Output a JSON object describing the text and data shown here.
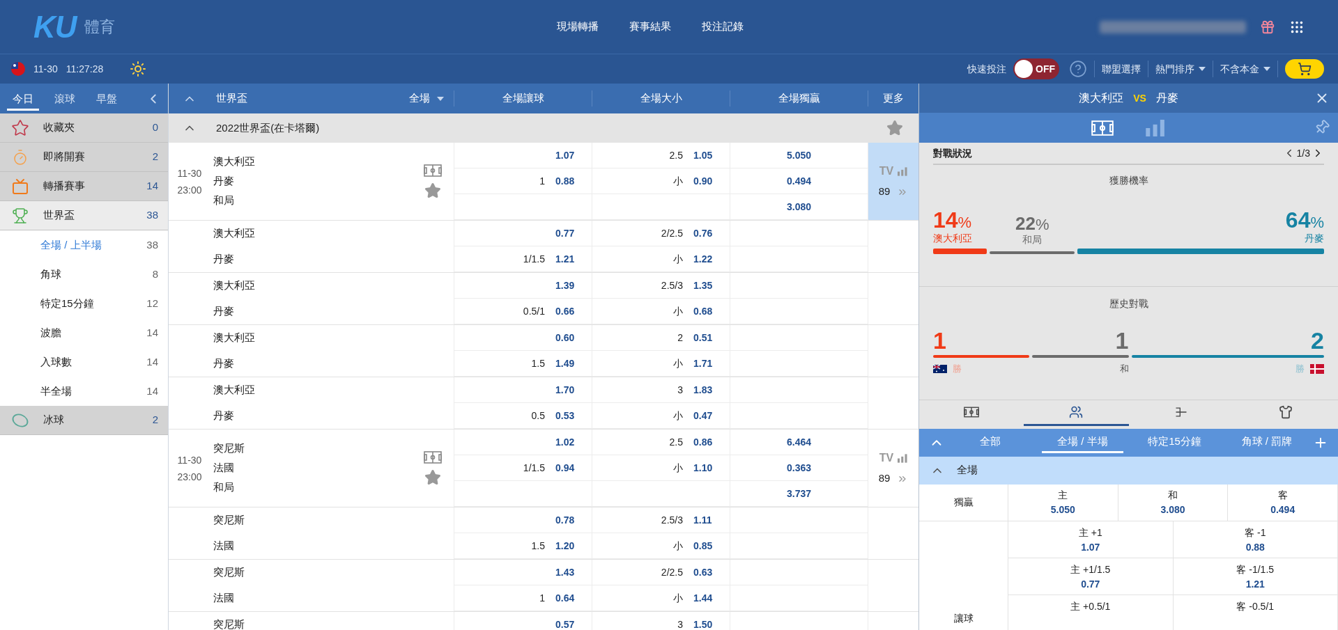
{
  "header": {
    "logo": {
      "mark": "KU",
      "name": "體育"
    },
    "nav": [
      "現場轉播",
      "賽事結果",
      "投注記錄"
    ]
  },
  "subbar": {
    "date": "11-30",
    "time": "11:27:28",
    "quick_bet": {
      "label": "快速投注",
      "on": false,
      "state_label": "OFF"
    },
    "links": [
      {
        "label": "聯盟選擇",
        "dropdown": false
      },
      {
        "label": "熱門排序",
        "dropdown": true
      },
      {
        "label": "不含本金",
        "dropdown": true
      }
    ]
  },
  "sidebar": {
    "tabs": [
      {
        "label": "今日",
        "selected": true
      },
      {
        "label": "滾球",
        "selected": false
      },
      {
        "label": "早盤",
        "selected": false
      }
    ],
    "items": [
      {
        "kind": "favorites",
        "label": "收藏夾",
        "count": "0",
        "expanded": false
      },
      {
        "kind": "upcoming",
        "label": "即將開賽",
        "count": "2",
        "expanded": false
      },
      {
        "kind": "tv",
        "label": "轉播賽事",
        "count": "14",
        "expanded": false
      },
      {
        "kind": "cup",
        "label": "世界盃",
        "count": "38",
        "expanded": true,
        "children": [
          {
            "label": "全場 / 上半場",
            "count": "38",
            "selected": true
          },
          {
            "label": "角球",
            "count": "8",
            "selected": false
          },
          {
            "label": "特定15分鐘",
            "count": "12",
            "selected": false
          },
          {
            "label": "波膽",
            "count": "14",
            "selected": false
          },
          {
            "label": "入球數",
            "count": "14",
            "selected": false
          },
          {
            "label": "半全場",
            "count": "14",
            "selected": false
          }
        ]
      },
      {
        "kind": "hockey",
        "label": "冰球",
        "count": "2",
        "expanded": false
      }
    ]
  },
  "odds_table": {
    "league": "世界盃",
    "period": "全場",
    "columns": [
      "全場讓球",
      "全場大小",
      "全場獨贏"
    ],
    "more": "更多",
    "group": "2022世界盃(在卡塔爾)",
    "matches": [
      {
        "date": "11-30",
        "time": "23:00",
        "tv": {
          "label": "TV",
          "count": "89",
          "selected": true
        },
        "blocks": [
          {
            "teams": [
              "澳大利亞",
              "丹麥",
              "和局"
            ],
            "handicap": [
              {
                "odds": "1.07"
              },
              {
                "line": "1",
                "odds": "0.88"
              }
            ],
            "total": [
              {
                "line": "2.5",
                "odds": "1.05"
              },
              {
                "line": "小",
                "odds": "0.90"
              }
            ],
            "moneyline": [
              "5.050",
              "0.494",
              "3.080"
            ]
          },
          {
            "teams": [
              "澳大利亞",
              "丹麥"
            ],
            "handicap": [
              {
                "odds": "0.77"
              },
              {
                "line": "1/1.5",
                "odds": "1.21"
              }
            ],
            "total": [
              {
                "line": "2/2.5",
                "odds": "0.76"
              },
              {
                "line": "小",
                "odds": "1.22"
              }
            ]
          },
          {
            "teams": [
              "澳大利亞",
              "丹麥"
            ],
            "handicap": [
              {
                "odds": "1.39"
              },
              {
                "line": "0.5/1",
                "odds": "0.66"
              }
            ],
            "total": [
              {
                "line": "2.5/3",
                "odds": "1.35"
              },
              {
                "line": "小",
                "odds": "0.68"
              }
            ]
          },
          {
            "teams": [
              "澳大利亞",
              "丹麥"
            ],
            "handicap": [
              {
                "odds": "0.60"
              },
              {
                "line": "1.5",
                "odds": "1.49"
              }
            ],
            "total": [
              {
                "line": "2",
                "odds": "0.51"
              },
              {
                "line": "小",
                "odds": "1.71"
              }
            ]
          },
          {
            "teams": [
              "澳大利亞",
              "丹麥"
            ],
            "handicap": [
              {
                "odds": "1.70"
              },
              {
                "line": "0.5",
                "odds": "0.53"
              }
            ],
            "total": [
              {
                "line": "3",
                "odds": "1.83"
              },
              {
                "line": "小",
                "odds": "0.47"
              }
            ]
          }
        ]
      },
      {
        "date": "11-30",
        "time": "23:00",
        "tv": {
          "label": "TV",
          "count": "89",
          "selected": false
        },
        "blocks": [
          {
            "teams": [
              "突尼斯",
              "法國",
              "和局"
            ],
            "handicap": [
              {
                "odds": "1.02"
              },
              {
                "line": "1/1.5",
                "odds": "0.94"
              }
            ],
            "total": [
              {
                "line": "2.5",
                "odds": "0.86"
              },
              {
                "line": "小",
                "odds": "1.10"
              }
            ],
            "moneyline": [
              "6.464",
              "0.363",
              "3.737"
            ]
          },
          {
            "teams": [
              "突尼斯",
              "法國"
            ],
            "handicap": [
              {
                "odds": "0.78"
              },
              {
                "line": "1.5",
                "odds": "1.20"
              }
            ],
            "total": [
              {
                "line": "2.5/3",
                "odds": "1.11"
              },
              {
                "line": "小",
                "odds": "0.85"
              }
            ]
          },
          {
            "teams": [
              "突尼斯",
              "法國"
            ],
            "handicap": [
              {
                "odds": "1.43"
              },
              {
                "line": "1",
                "odds": "0.64"
              }
            ],
            "total": [
              {
                "line": "2/2.5",
                "odds": "0.63"
              },
              {
                "line": "小",
                "odds": "1.44"
              }
            ]
          },
          {
            "teams": [
              "突尼斯"
            ],
            "handicap": [
              {
                "odds": "0.57"
              }
            ],
            "total": [
              {
                "line": "3",
                "odds": "1.50"
              }
            ]
          }
        ]
      }
    ]
  },
  "match_panel": {
    "home": "澳大利亞",
    "vs": "VS",
    "away": "丹麥",
    "views": [
      {
        "kind": "pitch",
        "selected": true
      },
      {
        "kind": "stats",
        "selected": false
      }
    ],
    "section": "對戰狀況",
    "pager": "1/3",
    "win_probability": {
      "title": "獲勝機率",
      "items": [
        {
          "value": "14",
          "unit": "%",
          "label": "澳大利亞",
          "color": "#f03a17"
        },
        {
          "value": "22",
          "unit": "%",
          "label": "和局",
          "color": "#6b6b6b"
        },
        {
          "value": "64",
          "unit": "%",
          "label": "丹麥",
          "color": "#1683a3"
        }
      ]
    },
    "history": {
      "title": "歷史對戰",
      "items": [
        {
          "value": "1",
          "label": "勝",
          "color": "#f03a17"
        },
        {
          "value": "1",
          "label": "和",
          "color": "#6b6b6b"
        },
        {
          "value": "2",
          "label": "勝",
          "color": "#1683a3"
        }
      ]
    },
    "icon_tabs": [
      {
        "kind": "pitch",
        "selected": false
      },
      {
        "kind": "players",
        "selected": true
      },
      {
        "kind": "bracket",
        "selected": false
      },
      {
        "kind": "shirt",
        "selected": false
      }
    ],
    "market_tabs": [
      {
        "label": "全部",
        "selected": false
      },
      {
        "label": "全場 / 半場",
        "selected": true
      },
      {
        "label": "特定15分鐘",
        "selected": false
      },
      {
        "label": "角球 / 罰牌",
        "selected": false
      }
    ],
    "market_section": "全場",
    "moneyline": {
      "label": "獨贏",
      "options": [
        {
          "label": "主",
          "odds": "5.050"
        },
        {
          "label": "和",
          "odds": "3.080"
        },
        {
          "label": "客",
          "odds": "0.494"
        }
      ]
    },
    "handicap": {
      "label": "讓球",
      "rows": [
        [
          {
            "label": "主 +1",
            "odds": "1.07"
          },
          {
            "label": "客 -1",
            "odds": "0.88"
          }
        ],
        [
          {
            "label": "主 +1/1.5",
            "odds": "0.77"
          },
          {
            "label": "客 -1/1.5",
            "odds": "1.21"
          }
        ],
        [
          {
            "label": "主 +0.5/1"
          },
          {
            "label": "客 -0.5/1"
          }
        ]
      ]
    }
  }
}
